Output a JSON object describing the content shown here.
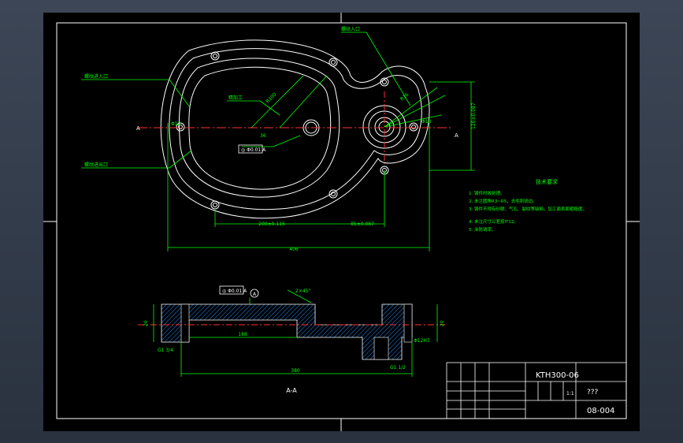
{
  "drawing": {
    "title_block": {
      "part_name": "KTH300-06",
      "material": "???",
      "drawing_number": "08-004",
      "scale": "1:1"
    },
    "section_label": "A-A",
    "section_mark": "A",
    "datum_label": "A",
    "technical_requirements_title": "技术要求",
    "technical_requirements": [
      "1. 铸件时效处理。",
      "2. 未注圆角R3~R5，去毛刺锐边。",
      "3. 铸件不得有砂眼、气孔、裂纹等缺陷，加工面表面粗糙度。",
      "4. 未注尺寸公差按IT12。",
      "5. 涂防锈漆。"
    ],
    "dimensions": {
      "overall_width": "406",
      "hole_spacing_main": "200±0.115",
      "hole_spacing_small": "85±0.087",
      "vertical_dim": "120±0.087",
      "section_width": "380",
      "section_inner": "188",
      "bore_dia": "Φ12",
      "boss_dia": "Φ18",
      "offset": "36",
      "radius_big": "R100",
      "radius_small": "R16",
      "depth": "20",
      "thread_left": "G1 3/4",
      "thread_right": "G1 1/2",
      "fit": "Φ12H7",
      "chamfer": "2×45°"
    },
    "leaders": [
      "螺纹进入口",
      "螺纹进出口",
      "精加工",
      "螺纹入口"
    ],
    "gd_t": "◎ Φ0.01 A"
  }
}
